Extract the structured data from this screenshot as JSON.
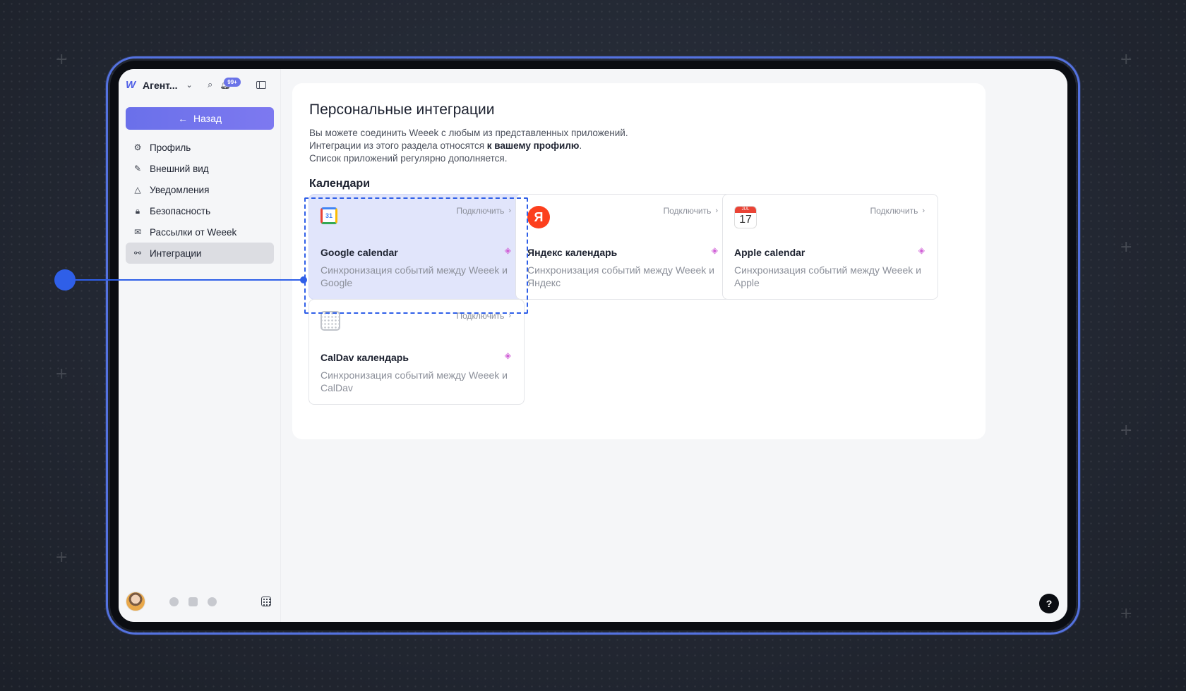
{
  "sidebar": {
    "workspace_name": "Агент...",
    "notifications_badge": "99+",
    "back_label": "Назад",
    "items": [
      {
        "label": "Профиль",
        "icon": "gear-icon",
        "active": false
      },
      {
        "label": "Внешний вид",
        "icon": "brush-icon",
        "active": false
      },
      {
        "label": "Уведомления",
        "icon": "bell-icon",
        "active": false
      },
      {
        "label": "Безопасность",
        "icon": "lock-icon",
        "active": false
      },
      {
        "label": "Рассылки от Weeek",
        "icon": "mail-icon",
        "active": false
      },
      {
        "label": "Интеграции",
        "icon": "integrations-icon",
        "active": true
      }
    ]
  },
  "main": {
    "title": "Персональные интеграции",
    "desc_line1": "Вы можете соединить Weeek с любым из представленных приложений.",
    "desc_line2_prefix": "Интеграции из этого раздела относятся ",
    "desc_line2_bold": "к вашему профилю",
    "desc_line2_suffix": ".",
    "desc_line3": "Список приложений регулярно дополняется.",
    "section_title": "Календари",
    "cards": [
      {
        "name": "Google calendar",
        "connect": "Подключить",
        "desc": "Синхронизация событий между Weeek и Google",
        "icon": "google-calendar-icon"
      },
      {
        "name": "Яндекс календарь",
        "connect": "Подключить",
        "desc": "Синхронизация событий между Weeek и Яндекс",
        "icon": "yandex-icon"
      },
      {
        "name": "Apple calendar",
        "connect": "Подключить",
        "desc": "Синхронизация событий между Weeek и Apple",
        "icon": "apple-calendar-icon"
      },
      {
        "name": "CalDav календарь",
        "connect": "Подключить",
        "desc": "Синхронизация событий между Weeek и CalDav",
        "icon": "caldav-icon"
      }
    ],
    "google_day": "31",
    "yandex_letter": "Я",
    "apple_month": "JUL",
    "apple_day": "17"
  },
  "help_label": "?",
  "colors": {
    "accent": "#6a70ea",
    "annotation": "#2f5fe8",
    "selected_card": "#e1e5fb"
  }
}
